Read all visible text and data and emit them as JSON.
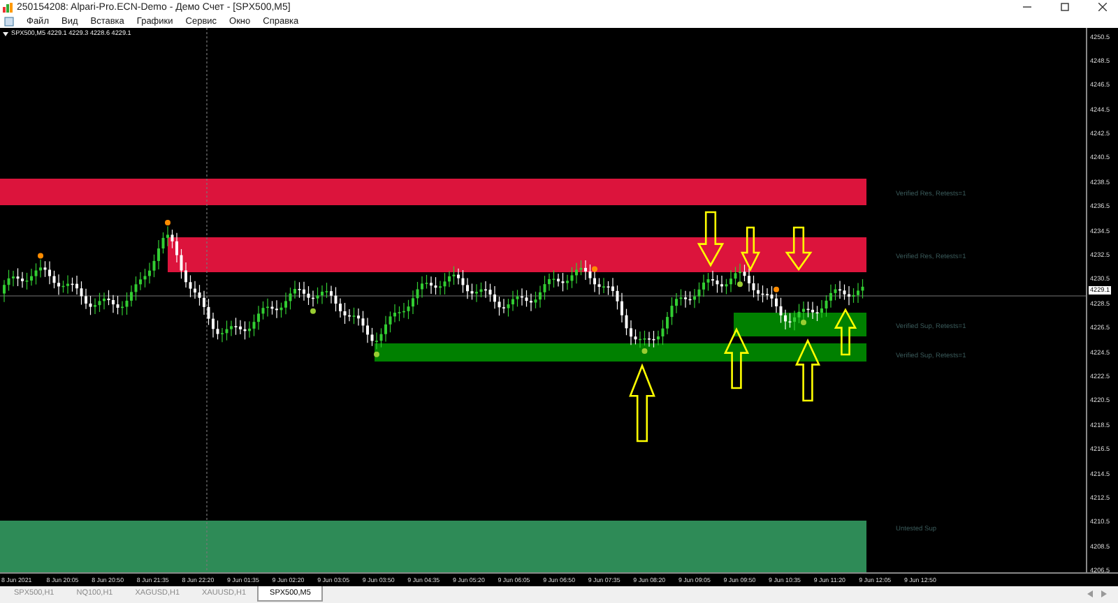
{
  "window": {
    "title": "250154208: Alpari-Pro.ECN-Demo - Демо Счет - [SPX500,M5]"
  },
  "menu": [
    "Файл",
    "Вид",
    "Вставка",
    "Графики",
    "Сервис",
    "Окно",
    "Справка"
  ],
  "chart": {
    "symbol": "SPX500,M5",
    "quote": "4229.1 4229.3 4228.6 4229.1",
    "zones": [
      {
        "label": "Verified Res, Retests=1",
        "color": "#dc143c"
      },
      {
        "label": "Verified Res, Retests=1",
        "color": "#dc143c"
      },
      {
        "label": "Verified Sup, Retests=1",
        "color": "#008000"
      },
      {
        "label": "Verified Sup, Retests=1",
        "color": "#008000"
      },
      {
        "label": "Untested Sup",
        "color": "#2e8b57"
      }
    ],
    "arrows": [
      {
        "kind": "down"
      },
      {
        "kind": "down"
      },
      {
        "kind": "down"
      },
      {
        "kind": "up"
      },
      {
        "kind": "up"
      },
      {
        "kind": "up"
      },
      {
        "kind": "up"
      }
    ],
    "price_axis": [
      "4250.5",
      "4248.5",
      "4246.5",
      "4244.5",
      "4242.5",
      "4240.5",
      "4238.5",
      "4236.5",
      "4234.5",
      "4232.5",
      "4230.5",
      "4228.5",
      "4226.5",
      "4224.5",
      "4222.5",
      "4220.5",
      "4218.5",
      "4216.5",
      "4214.5",
      "4212.5",
      "4210.5",
      "4208.5",
      "4206.5"
    ],
    "current_price": "4229.1",
    "time_axis": [
      "8 Jun 2021",
      "8 Jun 20:05",
      "8 Jun 20:50",
      "8 Jun 21:35",
      "8 Jun 22:20",
      "9 Jun 01:35",
      "9 Jun 02:20",
      "9 Jun 03:05",
      "9 Jun 03:50",
      "9 Jun 04:35",
      "9 Jun 05:20",
      "9 Jun 06:05",
      "9 Jun 06:50",
      "9 Jun 07:35",
      "9 Jun 08:20",
      "9 Jun 09:05",
      "9 Jun 09:50",
      "9 Jun 10:35",
      "9 Jun 11:20",
      "9 Jun 12:05",
      "9 Jun 12:50"
    ]
  },
  "tabs": [
    {
      "label": "SPX500,H1",
      "selected": false
    },
    {
      "label": "NQ100,H1",
      "selected": false
    },
    {
      "label": "XAGUSD,H1",
      "selected": false
    },
    {
      "label": "XAUUSD,H1",
      "selected": false
    },
    {
      "label": "SPX500,M5",
      "selected": true
    }
  ]
}
